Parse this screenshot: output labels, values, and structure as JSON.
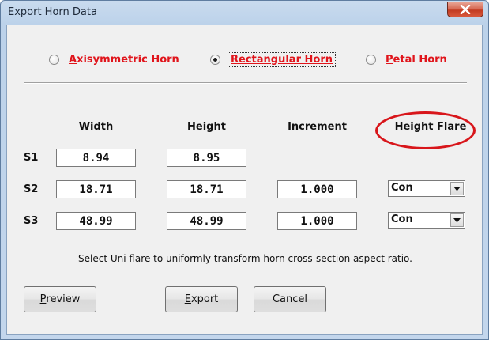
{
  "window": {
    "title": "Export Horn Data"
  },
  "horn_type": {
    "options": [
      {
        "key": "A",
        "rest": "xisymmetric Horn",
        "checked": false
      },
      {
        "key": "R",
        "rest": "ectangular Horn",
        "checked": true
      },
      {
        "key": "P",
        "rest": "etal Horn",
        "checked": false
      }
    ]
  },
  "columns": {
    "width": "Width",
    "height": "Height",
    "increment": "Increment",
    "height_flare": "Height Flare"
  },
  "rows": [
    {
      "label": "S1",
      "width": "8.94",
      "height": "8.95"
    },
    {
      "label": "S2",
      "width": "18.71",
      "height": "18.71",
      "increment": "1.000",
      "flare": "Con"
    },
    {
      "label": "S3",
      "width": "48.99",
      "height": "48.99",
      "increment": "1.000",
      "flare": "Con"
    }
  ],
  "hint": "Select Uni flare to uniformly transform horn cross-section aspect ratio.",
  "buttons": {
    "preview": {
      "key": "P",
      "rest": "review"
    },
    "export": {
      "key": "E",
      "rest": "xport"
    },
    "cancel": "Cancel"
  },
  "colors": {
    "radio_label": "#e0141b",
    "annotation": "#d8161b",
    "close_button": "#c23b22"
  },
  "icons": {
    "close": "close-x-icon",
    "dropdown": "chevron-down-icon"
  }
}
